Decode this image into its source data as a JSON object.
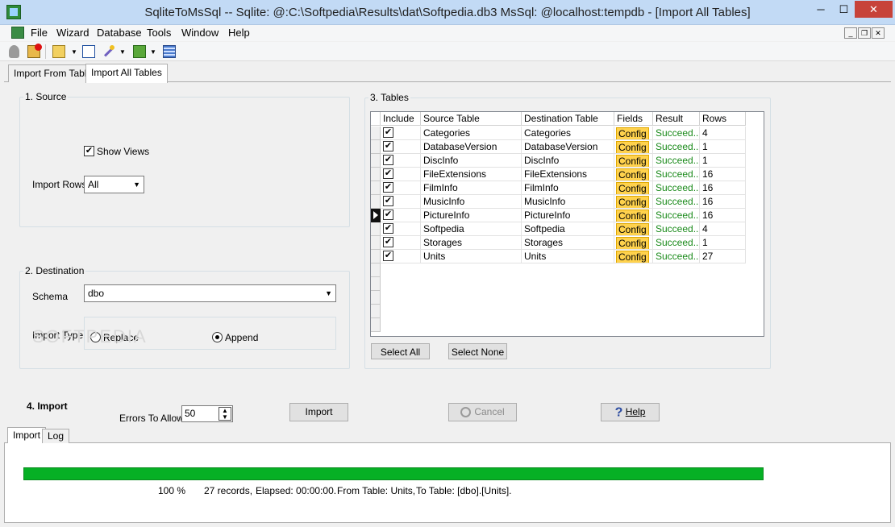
{
  "window": {
    "title": "SqliteToMsSql -- Sqlite: @:C:\\Softpedia\\Results\\dat\\Softpedia.db3 MsSql: @localhost:tempdb - [Import All Tables]",
    "minimize": "─",
    "maximize": "☐",
    "close": "✕"
  },
  "menu": [
    "File",
    "Wizard",
    "Database",
    "Tools",
    "Window",
    "Help"
  ],
  "mdi": {
    "min": "_",
    "restore": "❐",
    "close": "✕"
  },
  "toolbar_icons": [
    "connect-icon",
    "disconnect-icon",
    "import-icon",
    "export-icon",
    "wizard-icon",
    "refresh-icon",
    "grid-icon"
  ],
  "tabs": [
    {
      "label": "Import From Table",
      "selected": false
    },
    {
      "label": "Import All Tables",
      "selected": true
    }
  ],
  "source": {
    "legend": "1. Source",
    "show_views_label": "Show Views",
    "show_views_checked": "✔",
    "import_rows_label": "Import Rows",
    "import_rows_value": "All"
  },
  "destination": {
    "legend": "2. Destination",
    "schema_label": "Schema",
    "schema_value": "dbo",
    "import_type_label": "Import Type",
    "replace_label": "Replace",
    "append_label": "Append",
    "selected_type": "Append"
  },
  "tables": {
    "legend": "3. Tables",
    "columns": [
      "Include",
      "Source Table",
      "Destination Table",
      "Fields",
      "Result",
      "Rows"
    ],
    "check_glyph": "✔",
    "rows": [
      {
        "source": "Categories",
        "dest": "Categories",
        "fields": "Config",
        "result": "Succeed...",
        "rows": "4"
      },
      {
        "source": "DatabaseVersion",
        "dest": "DatabaseVersion",
        "fields": "Config",
        "result": "Succeed...",
        "rows": "1"
      },
      {
        "source": "DiscInfo",
        "dest": "DiscInfo",
        "fields": "Config",
        "result": "Succeed...",
        "rows": "1"
      },
      {
        "source": "FileExtensions",
        "dest": "FileExtensions",
        "fields": "Config",
        "result": "Succeed...",
        "rows": "16"
      },
      {
        "source": "FilmInfo",
        "dest": "FilmInfo",
        "fields": "Config",
        "result": "Succeed...",
        "rows": "16"
      },
      {
        "source": "MusicInfo",
        "dest": "MusicInfo",
        "fields": "Config",
        "result": "Succeed...",
        "rows": "16"
      },
      {
        "source": "PictureInfo",
        "dest": "PictureInfo",
        "fields": "Config",
        "result": "Succeed...",
        "rows": "16"
      },
      {
        "source": "Softpedia",
        "dest": "Softpedia",
        "fields": "Config",
        "result": "Succeed...",
        "rows": "4"
      },
      {
        "source": "Storages",
        "dest": "Storages",
        "fields": "Config",
        "result": "Succeed...",
        "rows": "1"
      },
      {
        "source": "Units",
        "dest": "Units",
        "fields": "Config",
        "result": "Succeed...",
        "rows": "27"
      }
    ],
    "current_row": 6,
    "select_all": "Select All",
    "select_none": "Select None"
  },
  "import": {
    "heading": "4. Import",
    "errors_label": "Errors To Allow",
    "errors_value": "50",
    "import_button": "Import",
    "cancel_button": "Cancel",
    "help_button": "Help"
  },
  "bottom_tabs": [
    {
      "label": "Import",
      "selected": true
    },
    {
      "label": "Log",
      "selected": false
    }
  ],
  "status": {
    "progress_fraction": 1.0,
    "percent": "100 %",
    "records": "27 records,",
    "elapsed": "Elapsed: 00:00:00.",
    "from_table": "From Table: Units,",
    "to_table": "To Table: [dbo].[Units]."
  },
  "colors": {
    "progress": "#06b025",
    "config": "#ffd24d",
    "success": "#1a8a1a",
    "titlebar": "#c2daf5",
    "close": "#c7433a"
  }
}
